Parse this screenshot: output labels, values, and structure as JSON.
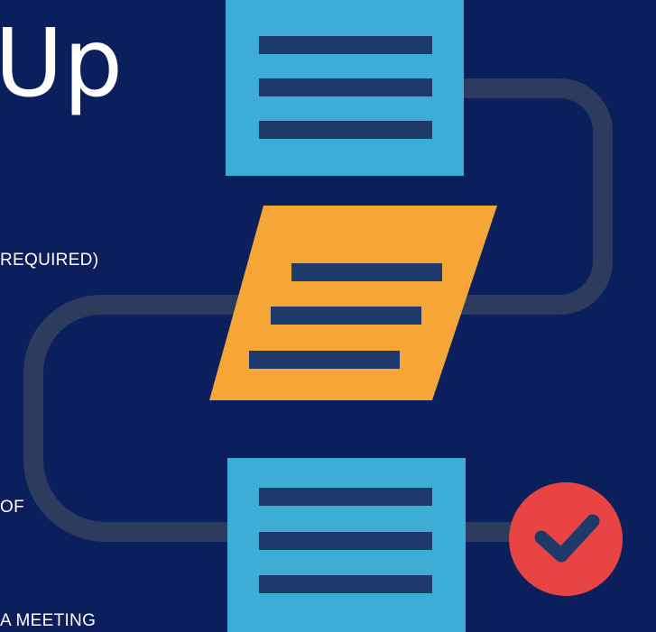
{
  "slide": {
    "title": "Up",
    "fragments": [
      "REQUIRED)",
      "OF",
      "A MEETING"
    ]
  },
  "diagram": {
    "shapes": [
      {
        "type": "document",
        "color": "#3dadd6",
        "lines": 3
      },
      {
        "type": "parallelogram",
        "color": "#f5a637",
        "lines": 3
      },
      {
        "type": "document",
        "color": "#3dadd6",
        "lines": 3
      },
      {
        "type": "check-circle",
        "color": "#e84444"
      }
    ],
    "connector_color": "#2d3b5f",
    "line_color": "#1e3a6b"
  }
}
